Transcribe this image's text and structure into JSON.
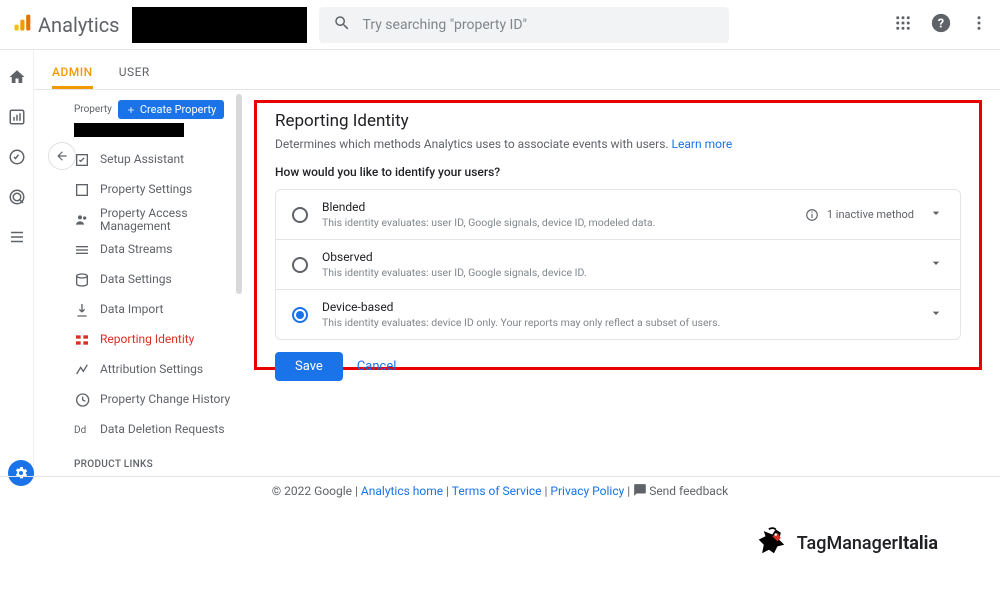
{
  "header": {
    "product": "Analytics",
    "search_placeholder": "Try searching \"property ID\""
  },
  "tabs": {
    "admin": "ADMIN",
    "user": "USER"
  },
  "sidebar": {
    "property_label": "Property",
    "create": "Create Property",
    "items": [
      "Setup Assistant",
      "Property Settings",
      "Property Access Management",
      "Data Streams",
      "Data Settings",
      "Data Import",
      "Reporting Identity",
      "Attribution Settings",
      "Property Change History",
      "Data Deletion Requests"
    ],
    "product_links": "PRODUCT LINKS"
  },
  "main": {
    "title": "Reporting Identity",
    "subtitle": "Determines which methods Analytics uses to associate events with users. ",
    "learn_more": "Learn more",
    "question": "How would you like to identify your users?",
    "options": [
      {
        "title": "Blended",
        "desc": "This identity evaluates: user ID, Google signals, device ID, modeled data.",
        "badge": "1 inactive method"
      },
      {
        "title": "Observed",
        "desc": "This identity evaluates: user ID, Google signals, device ID."
      },
      {
        "title": "Device-based",
        "desc": "This identity evaluates: device ID only. Your reports may only reflect a subset of users."
      }
    ],
    "save": "Save",
    "cancel": "Cancel"
  },
  "footer": {
    "copyright": "© 2022 Google",
    "links": [
      "Analytics home",
      "Terms of Service",
      "Privacy Policy"
    ],
    "feedback": "Send feedback"
  },
  "brand": {
    "name": "TagManager",
    "suffix": "Italia"
  }
}
